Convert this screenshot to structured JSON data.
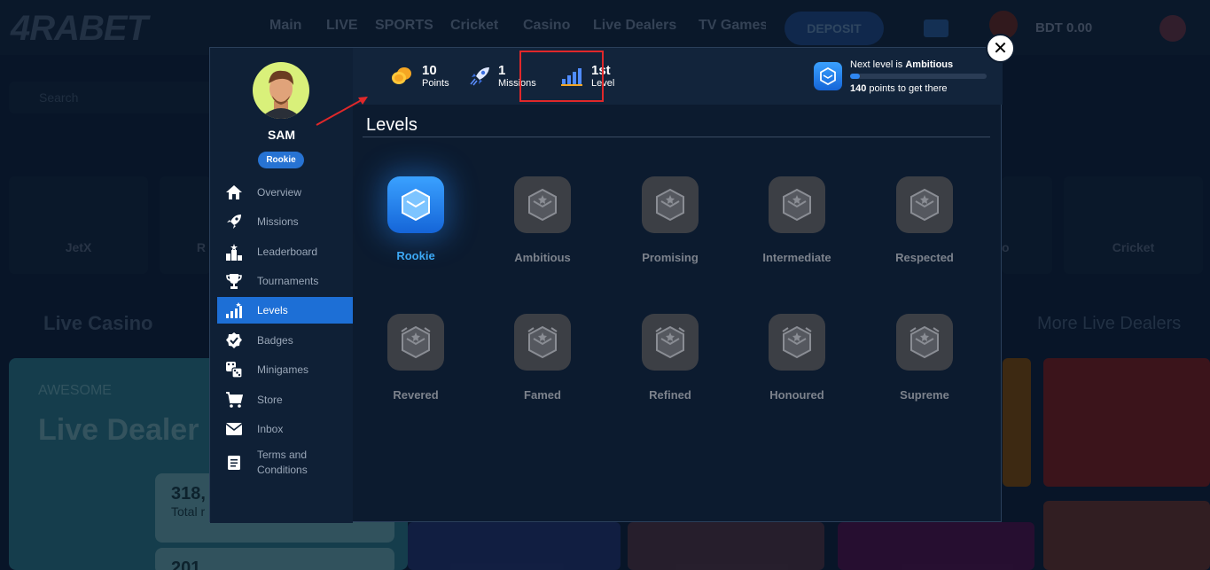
{
  "site": {
    "logo": "4RABET",
    "nav": [
      "Main",
      "LIVE",
      "SPORTS",
      "Cricket",
      "Casino",
      "Live Dealers",
      "TV Games"
    ],
    "deposit_label": "DEPOSIT",
    "balance": "BDT 0.00",
    "search_placeholder": "Search",
    "games": [
      "JetX",
      "R",
      "o",
      "Cricket"
    ],
    "live_casino_title": "Live Casino",
    "more_live": "More Live Dealers",
    "promo": {
      "kicker": "AWESOME",
      "title": "Live Dealer",
      "stat1_num": "318,",
      "stat1_lbl": "Total r",
      "stat2_num": "201"
    }
  },
  "modal": {
    "profile": {
      "name": "SAM",
      "level_badge": "Rookie"
    },
    "menu": [
      {
        "label": "Overview",
        "icon": "home-icon"
      },
      {
        "label": "Missions",
        "icon": "rocket-icon"
      },
      {
        "label": "Leaderboard",
        "icon": "podium-icon"
      },
      {
        "label": "Tournaments",
        "icon": "trophy-icon"
      },
      {
        "label": "Levels",
        "icon": "levels-icon",
        "active": true
      },
      {
        "label": "Badges",
        "icon": "badge-icon"
      },
      {
        "label": "Minigames",
        "icon": "dice-icon"
      },
      {
        "label": "Store",
        "icon": "cart-icon"
      },
      {
        "label": "Inbox",
        "icon": "mail-icon"
      },
      {
        "label": "Terms and",
        "label2": "Conditions",
        "icon": "document-icon"
      }
    ],
    "stats": {
      "points_num": "10",
      "points_lbl": "Points",
      "missions_num": "1",
      "missions_lbl": "Missions",
      "level_num": "1st",
      "level_lbl": "Level"
    },
    "next_level": {
      "prefix": "Next level is ",
      "name": "Ambitious",
      "points": "140",
      "suffix": " points to get there",
      "progress": 0.07
    },
    "levels_title": "Levels",
    "levels": [
      "Rookie",
      "Ambitious",
      "Promising",
      "Intermediate",
      "Respected",
      "Revered",
      "Famed",
      "Refined",
      "Honoured",
      "Supreme"
    ],
    "close_symbol": "✕"
  }
}
